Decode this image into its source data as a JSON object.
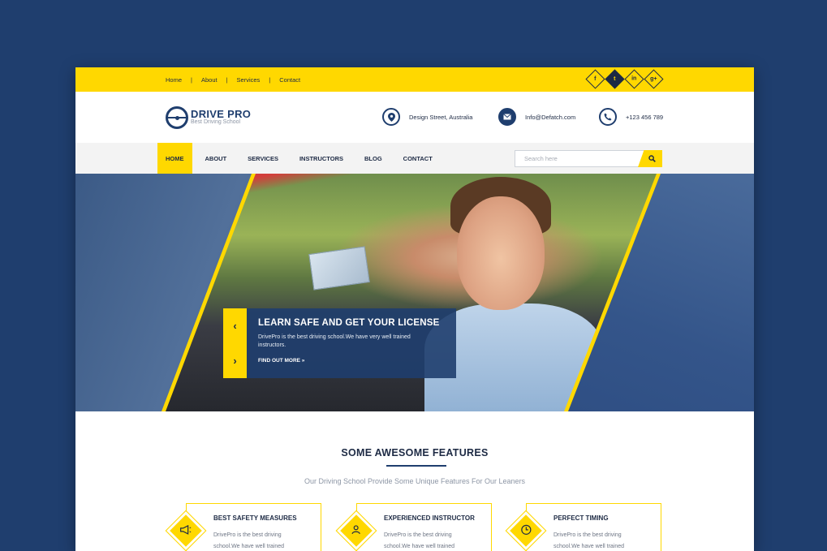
{
  "topbar": {
    "links": [
      "Home",
      "About",
      "Services",
      "Contact"
    ],
    "separator": "|",
    "socials": [
      {
        "icon": "facebook-icon",
        "glyph": "f"
      },
      {
        "icon": "twitter-icon",
        "glyph": "t"
      },
      {
        "icon": "linkedin-icon",
        "glyph": "in"
      },
      {
        "icon": "google-plus-icon",
        "glyph": "g+"
      }
    ]
  },
  "header": {
    "brand": "DRIVE PRO",
    "tagline": "Best Driving School",
    "address": "Design Street, Australia",
    "email": "Info@Defatch.com",
    "phone": "+123 456 789",
    "icons": {
      "address": "location-pin-icon",
      "email": "envelope-icon",
      "phone": "phone-icon"
    }
  },
  "nav": {
    "items": [
      "HOME",
      "ABOUT",
      "SERVICES",
      "INSTRUCTORS",
      "BLOG",
      "CONTACT"
    ],
    "active_index": 0,
    "search_placeholder": "Search here"
  },
  "hero": {
    "title": "LEARN SAFE AND GET YOUR LICENSE",
    "text": "DrivePro is the best driving school.We have very well trained instructors.",
    "cta": "FIND OUT MORE »",
    "prev_glyph": "‹",
    "next_glyph": "›"
  },
  "features": {
    "title": "SOME AWESOME FEATURES",
    "subtitle": "Our Driving School Provide Some Unique Features For Our Leaners",
    "items": [
      {
        "name": "BEST SAFETY MEASURES",
        "text": "DrivePro is the best driving school.We have well trained",
        "icon": "megaphone-icon"
      },
      {
        "name": "EXPERIENCED INSTRUCTOR",
        "text": "DrivePro is the best driving school.We have well trained",
        "icon": "users-icon"
      },
      {
        "name": "PERFECT TIMING",
        "text": "DrivePro is the best driving school.We have well trained",
        "icon": "clock-icon"
      }
    ]
  },
  "colors": {
    "brand": "#1f3e6e",
    "accent": "#ffd800",
    "background": "#1f3e6e"
  }
}
